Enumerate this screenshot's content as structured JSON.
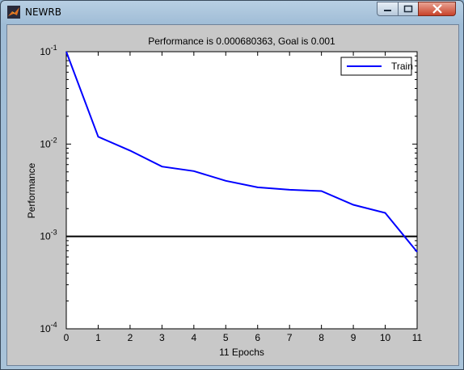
{
  "window": {
    "title": "NEWRB",
    "controls": {
      "minimize_icon": "minimize-icon",
      "maximize_icon": "maximize-icon",
      "close_icon": "close-icon"
    }
  },
  "chart_data": {
    "type": "line",
    "title": "Performance is 0.000680363, Goal is 0.001",
    "xlabel": "11 Epochs",
    "ylabel": "Performance",
    "xlim": [
      0,
      11
    ],
    "ylim": [
      0.0001,
      0.1
    ],
    "yscale": "log",
    "x_ticks": [
      "0",
      "1",
      "2",
      "3",
      "4",
      "5",
      "6",
      "7",
      "8",
      "9",
      "10",
      "11"
    ],
    "y_ticks": [
      {
        "base": "10",
        "exp": "-4",
        "value": 0.0001
      },
      {
        "base": "10",
        "exp": "-3",
        "value": 0.001
      },
      {
        "base": "10",
        "exp": "-2",
        "value": 0.01
      },
      {
        "base": "10",
        "exp": "-1",
        "value": 0.1
      }
    ],
    "series": [
      {
        "name": "Train",
        "color": "#0000ff",
        "x": [
          0,
          1,
          2,
          3,
          4,
          5,
          6,
          7,
          8,
          9,
          10,
          11
        ],
        "y": [
          0.1,
          0.012,
          0.0085,
          0.0057,
          0.0051,
          0.004,
          0.0034,
          0.0032,
          0.0031,
          0.0022,
          0.0018,
          0.00068
        ]
      }
    ],
    "goal": {
      "value": 0.001,
      "color": "#000000"
    },
    "legend": {
      "position": "top-right"
    },
    "grid": false
  }
}
